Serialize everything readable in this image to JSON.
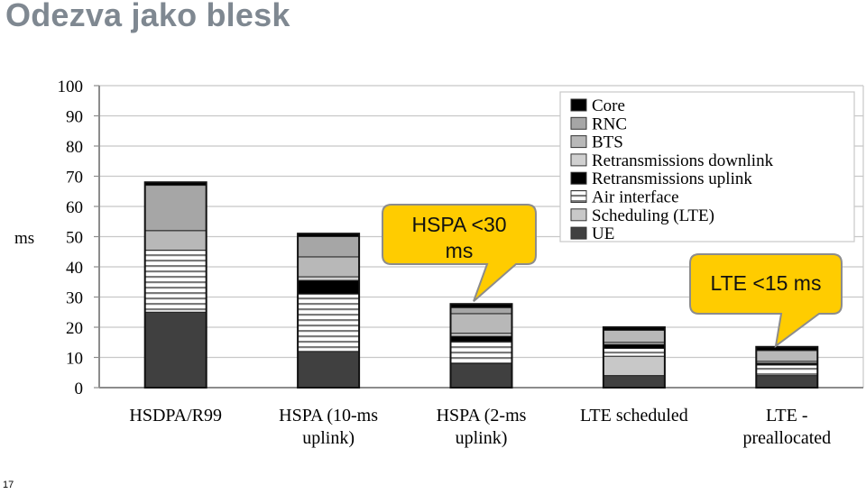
{
  "slide": {
    "title": "Odezva jako blesk",
    "page_number": "17"
  },
  "chart_data": {
    "type": "bar",
    "stacked": true,
    "title": "",
    "xlabel": "",
    "ylabel": "ms",
    "ylim": [
      0,
      100
    ],
    "yticks": [
      0,
      10,
      20,
      30,
      40,
      50,
      60,
      70,
      80,
      90,
      100
    ],
    "grid": true,
    "legend_position": "top-right",
    "categories": [
      [
        "HSDPA/R99"
      ],
      [
        "HSPA (10-ms",
        "uplink)"
      ],
      [
        "HSPA (2-ms",
        "uplink)"
      ],
      [
        "LTE scheduled"
      ],
      [
        "LTE -",
        "preallocated"
      ]
    ],
    "series": [
      {
        "name": "UE",
        "color": "#404040",
        "pattern": "solid",
        "values": [
          25,
          12,
          8,
          4,
          4
        ]
      },
      {
        "name": "Scheduling (LTE)",
        "color": "#c8c8c8",
        "pattern": "solid",
        "values": [
          0,
          0,
          0,
          6.4,
          0
        ]
      },
      {
        "name": "Air interface",
        "color": "#ffffff",
        "pattern": "hlines",
        "values": [
          20.5,
          19,
          7.2,
          2.6,
          3.5
        ]
      },
      {
        "name": "Retransmissions uplink",
        "color": "#000000",
        "pattern": "solid",
        "values": [
          0,
          4.5,
          1.8,
          1.3,
          0.6
        ]
      },
      {
        "name": "Retransmissions downlink",
        "color": "#d0d0d0",
        "pattern": "solid",
        "values": [
          0,
          1.2,
          1,
          0.7,
          0.6
        ]
      },
      {
        "name": "BTS",
        "color": "#b8b8b8",
        "pattern": "solid",
        "values": [
          6.5,
          6.6,
          6.5,
          4,
          3.6
        ]
      },
      {
        "name": "RNC",
        "color": "#a6a6a6",
        "pattern": "solid",
        "values": [
          15,
          6.7,
          2,
          0,
          0
        ]
      },
      {
        "name": "Core",
        "color": "#000000",
        "pattern": "solid",
        "values": [
          1,
          1,
          1.2,
          1,
          1.2
        ]
      }
    ],
    "legend_order": [
      "Core",
      "RNC",
      "BTS",
      "Retransmissions downlink",
      "Retransmissions uplink",
      "Air interface",
      "Scheduling (LTE)",
      "UE"
    ],
    "annotations": [
      {
        "text": [
          "HSPA <30",
          "ms"
        ],
        "points_to_category": 2,
        "color": "#ffcc00"
      },
      {
        "text": [
          "LTE <15 ms"
        ],
        "points_to_category": 4,
        "color": "#ffcc00"
      }
    ]
  }
}
